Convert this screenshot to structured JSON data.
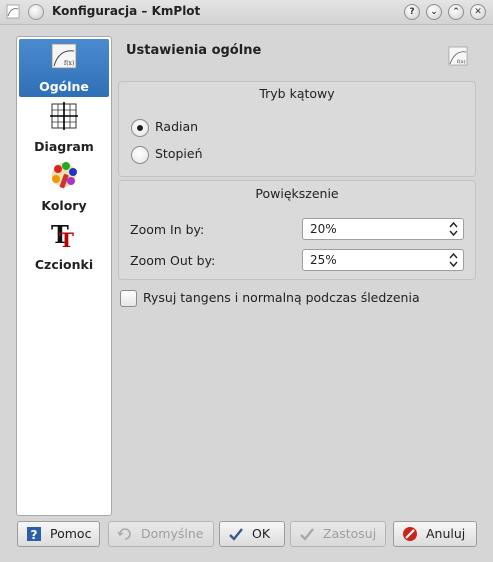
{
  "window": {
    "title": "Konfiguracja – KmPlot",
    "buttons": [
      "help",
      "minimize",
      "maximize",
      "close"
    ]
  },
  "sidebar": {
    "items": [
      {
        "label": "Ogólne",
        "icon": "general-settings-icon",
        "active": true
      },
      {
        "label": "Diagram",
        "icon": "grid-diagram-icon",
        "active": false
      },
      {
        "label": "Kolory",
        "icon": "color-palette-icon",
        "active": false
      },
      {
        "label": "Czcionki",
        "icon": "font-icon",
        "active": false
      }
    ]
  },
  "page": {
    "title": "Ustawienia ogólne",
    "icon": "kmplot-icon"
  },
  "angle_mode": {
    "title": "Tryb kątowy",
    "options": [
      {
        "label": "Radian",
        "selected": true
      },
      {
        "label": "Stopień",
        "selected": false
      }
    ]
  },
  "zoom": {
    "title": "Powiększenie",
    "zoom_in_label": "Zoom In by:",
    "zoom_in_value": "20%",
    "zoom_out_label": "Zoom Out by:",
    "zoom_out_value": "25%"
  },
  "trace_option": {
    "label": "Rysuj tangens i normalną podczas śledzenia",
    "checked": false
  },
  "footer": {
    "help": "Pomoc",
    "defaults": "Domyślne",
    "ok": "OK",
    "apply": "Zastosuj",
    "cancel": "Anuluj"
  },
  "colors": {
    "accent": "#2f6fb6",
    "background": "#d6d6d6"
  }
}
